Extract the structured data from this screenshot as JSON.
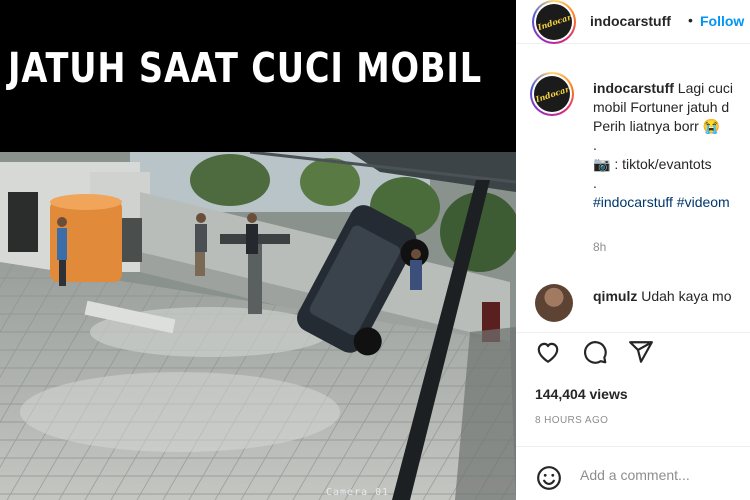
{
  "media": {
    "title": "JATUH SAAT CUCI MOBIL",
    "camera_label": "Camera 01"
  },
  "header": {
    "username": "indocarstuff",
    "separator": "•",
    "follow_label": "Follow",
    "avatar_text": "Indocar"
  },
  "caption": {
    "username": "indocarstuff",
    "line1": "Lagi cuci",
    "line2": "mobil Fortuner jatuh d",
    "line3": "Perih liatnya borr",
    "line3_emoji": "😭",
    "dot1": ".",
    "source_emoji": "📷",
    "source_text": ": tiktok/evantots",
    "dot2": ".",
    "hashtags": "#indocarstuff #videom",
    "time": "8h"
  },
  "comment": {
    "username": "qimulz",
    "text": "Udah kaya mo"
  },
  "actions": {
    "icons": [
      "heart-icon",
      "comment-icon",
      "share-icon"
    ]
  },
  "stats": {
    "views": "144,404 views",
    "posted": "8 HOURS AGO"
  },
  "add_comment": {
    "placeholder": "Add a comment..."
  },
  "colors": {
    "follow": "#0095f6",
    "hashtag": "#00376b",
    "muted": "#8e8e8e",
    "text": "#262626"
  }
}
